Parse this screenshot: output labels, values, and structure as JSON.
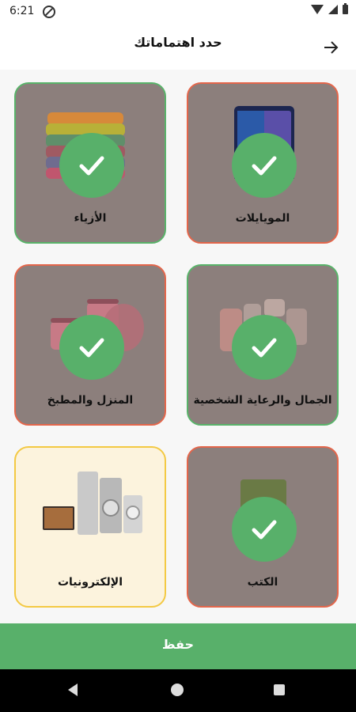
{
  "status_bar": {
    "time": "6:21"
  },
  "header": {
    "title": "حدد اهتماماتك"
  },
  "categories": [
    {
      "label": "المويايلات",
      "selected": true,
      "icon": "phone-image"
    },
    {
      "label": "الأزياء",
      "selected": true,
      "icon": "clothes-image"
    },
    {
      "label": "الجمال والرعاية الشخصية",
      "selected": true,
      "icon": "cosmetics-image"
    },
    {
      "label": "المنزل والمطبخ",
      "selected": true,
      "icon": "cookware-image"
    },
    {
      "label": "الكتب",
      "selected": true,
      "icon": "books-image"
    },
    {
      "label": "الإلكترونيات",
      "selected": false,
      "icon": "electronics-image"
    }
  ],
  "footer": {
    "save_label": "حفظ"
  },
  "colors": {
    "accent": "#58b06a",
    "selected_overlay": "#8c7f7c",
    "unselected_bg": "#fcf3dd",
    "border_green": "#59b36a",
    "border_red": "#e4664b",
    "border_yellow": "#f3c943"
  }
}
